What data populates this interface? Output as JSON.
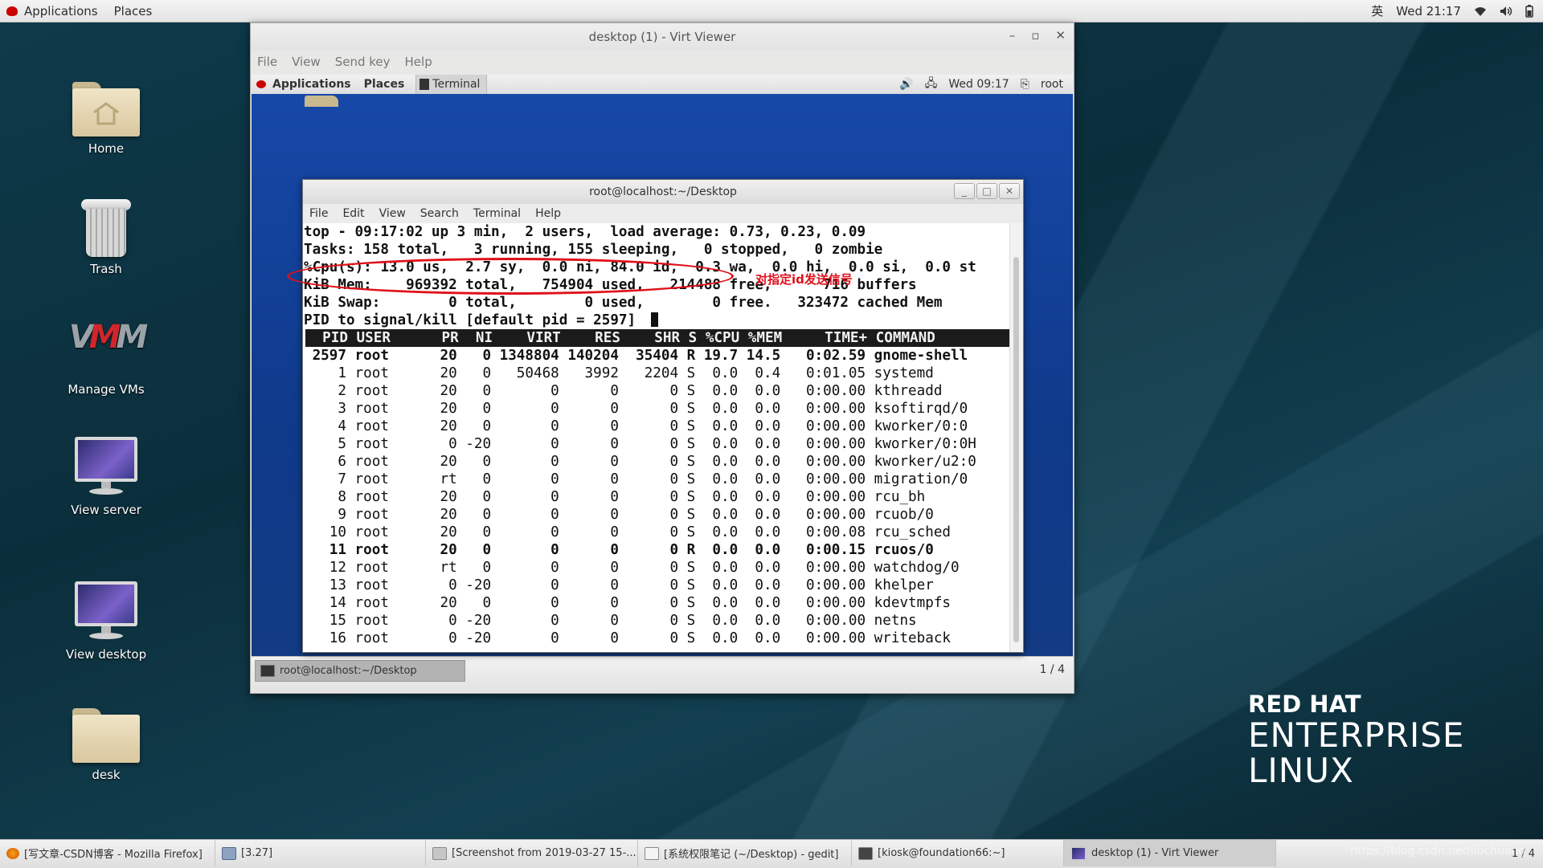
{
  "topbar": {
    "applications": "Applications",
    "places": "Places",
    "input_method": "英",
    "clock": "Wed 21:17"
  },
  "desktop_icons": {
    "home": "Home",
    "trash": "Trash",
    "manage_vms": "Manage VMs",
    "view_server": "View server",
    "view_desktop": "View desktop",
    "desk": "desk"
  },
  "branding": {
    "line1": "RED HAT",
    "line2": "ENTERPRISE",
    "line3": "LINUX"
  },
  "virt_viewer": {
    "title": "desktop (1) - Virt Viewer",
    "menu": [
      "File",
      "View",
      "Send key",
      "Help"
    ],
    "guest_panel": {
      "applications": "Applications",
      "places": "Places",
      "terminal_task": "Terminal",
      "clock": "Wed 09:17",
      "user": "root"
    },
    "guest_taskbar": {
      "task": "root@localhost:~/Desktop",
      "workspace": "1 / 4"
    }
  },
  "terminal": {
    "title": "root@localhost:~/Desktop",
    "menu": [
      "File",
      "Edit",
      "View",
      "Search",
      "Terminal",
      "Help"
    ],
    "summary": [
      "top - 09:17:02 up 3 min,  2 users,  load average: 0.73, 0.23, 0.09",
      "Tasks: 158 total,   3 running, 155 sleeping,   0 stopped,   0 zombie",
      "%Cpu(s): 13.0 us,  2.7 sy,  0.0 ni, 84.0 id,  0.3 wa,  0.0 hi,  0.0 si,  0.0 st",
      "KiB Mem:    969392 total,   754904 used,   214488 free,      716 buffers",
      "KiB Swap:        0 total,        0 used,        0 free.   323472 cached Mem"
    ],
    "prompt": "PID to signal/kill [default pid = 2597] ",
    "header": "  PID USER      PR  NI    VIRT    RES    SHR S %CPU %MEM     TIME+ COMMAND",
    "processes": [
      " 2597 root      20   0 1348804 140204  35404 R 19.7 14.5   0:02.59 gnome-shell",
      "    1 root      20   0   50468   3992   2204 S  0.0  0.4   0:01.05 systemd",
      "    2 root      20   0       0      0      0 S  0.0  0.0   0:00.00 kthreadd",
      "    3 root      20   0       0      0      0 S  0.0  0.0   0:00.00 ksoftirqd/0",
      "    4 root      20   0       0      0      0 S  0.0  0.0   0:00.00 kworker/0:0",
      "    5 root       0 -20       0      0      0 S  0.0  0.0   0:00.00 kworker/0:0H",
      "    6 root      20   0       0      0      0 S  0.0  0.0   0:00.00 kworker/u2:0",
      "    7 root      rt   0       0      0      0 S  0.0  0.0   0:00.00 migration/0",
      "    8 root      20   0       0      0      0 S  0.0  0.0   0:00.00 rcu_bh",
      "    9 root      20   0       0      0      0 S  0.0  0.0   0:00.00 rcuob/0",
      "   10 root      20   0       0      0      0 S  0.0  0.0   0:00.08 rcu_sched",
      "   11 root      20   0       0      0      0 R  0.0  0.0   0:00.15 rcuos/0",
      "   12 root      rt   0       0      0      0 S  0.0  0.0   0:00.00 watchdog/0",
      "   13 root       0 -20       0      0      0 S  0.0  0.0   0:00.00 khelper",
      "   14 root      20   0       0      0      0 S  0.0  0.0   0:00.00 kdevtmpfs",
      "   15 root       0 -20       0      0      0 S  0.0  0.0   0:00.00 netns",
      "   16 root       0 -20       0      0      0 S  0.0  0.0   0:00.00 writeback"
    ],
    "annotation": "对指定id发送信号"
  },
  "taskbar": {
    "items": [
      "[写文章-CSDN博客 - Mozilla Firefox]",
      "[3.27]",
      "[Screenshot from 2019-03-27 15-...",
      "[系统权限笔记 (~/Desktop) - gedit]",
      "[kiosk@foundation66:~]",
      "desktop (1) - Virt Viewer"
    ],
    "pager": "1 / 4",
    "watermark": "https://blog.csdn.net/liuchuang"
  },
  "colors": {
    "annotation": "#e0101a",
    "guest_background": "#123c8a",
    "redhat_red": "#cc0000"
  }
}
